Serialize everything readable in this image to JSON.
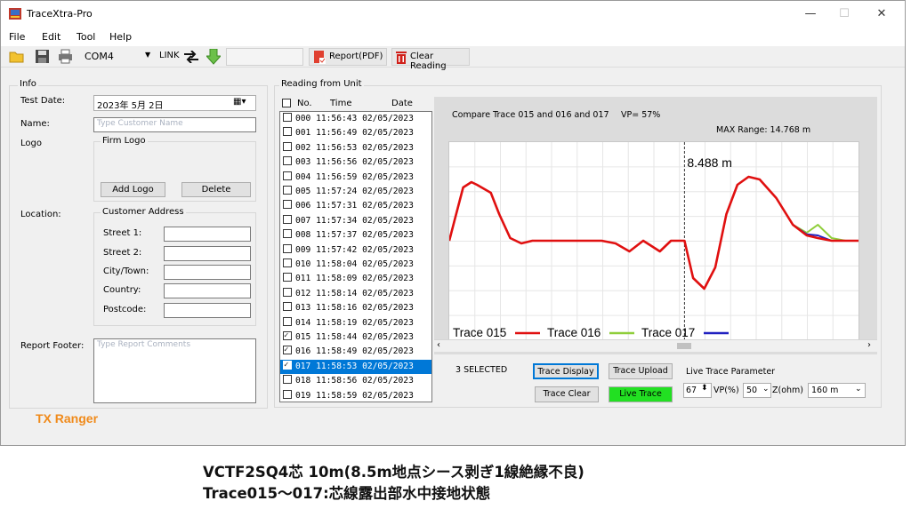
{
  "window": {
    "title": "TraceXtra-Pro",
    "controls": {
      "minimize": "—",
      "maximize": "☐",
      "close": "✕"
    }
  },
  "menu": [
    "File",
    "Edit",
    "Tool",
    "Help"
  ],
  "toolbar": {
    "port": "COM4",
    "link_label": "LINK",
    "report_label": "Report(PDF)",
    "clear_label": "Clear Reading"
  },
  "info": {
    "group_label": "Info",
    "test_date_label": "Test Date:",
    "test_date_value": "2023年 5月 2日",
    "name_label": "Name:",
    "name_placeholder": "Type Customer Name",
    "logo_label": "Logo",
    "firm_logo_label": "Firm Logo",
    "add_logo_button": "Add Logo",
    "delete_button": "Delete",
    "location_label": "Location:",
    "address_group": "Customer Address",
    "street1": "Street 1:",
    "street2": "Street 2:",
    "city": "City/Town:",
    "country": "Country:",
    "postcode": "Postcode:",
    "footer_label": "Report Footer:",
    "footer_placeholder": "Type Report Comments",
    "brand": "TX Ranger"
  },
  "readings": {
    "group_label": "Reading from Unit",
    "col_no": "No.",
    "col_time": "Time",
    "col_date": "Date",
    "rows": [
      {
        "no": "000",
        "time": "11:56:43",
        "date": "02/05/2023",
        "checked": false
      },
      {
        "no": "001",
        "time": "11:56:49",
        "date": "02/05/2023",
        "checked": false
      },
      {
        "no": "002",
        "time": "11:56:53",
        "date": "02/05/2023",
        "checked": false
      },
      {
        "no": "003",
        "time": "11:56:56",
        "date": "02/05/2023",
        "checked": false
      },
      {
        "no": "004",
        "time": "11:56:59",
        "date": "02/05/2023",
        "checked": false
      },
      {
        "no": "005",
        "time": "11:57:24",
        "date": "02/05/2023",
        "checked": false
      },
      {
        "no": "006",
        "time": "11:57:31",
        "date": "02/05/2023",
        "checked": false
      },
      {
        "no": "007",
        "time": "11:57:34",
        "date": "02/05/2023",
        "checked": false
      },
      {
        "no": "008",
        "time": "11:57:37",
        "date": "02/05/2023",
        "checked": false
      },
      {
        "no": "009",
        "time": "11:57:42",
        "date": "02/05/2023",
        "checked": false
      },
      {
        "no": "010",
        "time": "11:58:04",
        "date": "02/05/2023",
        "checked": false
      },
      {
        "no": "011",
        "time": "11:58:09",
        "date": "02/05/2023",
        "checked": false
      },
      {
        "no": "012",
        "time": "11:58:14",
        "date": "02/05/2023",
        "checked": false
      },
      {
        "no": "013",
        "time": "11:58:16",
        "date": "02/05/2023",
        "checked": false
      },
      {
        "no": "014",
        "time": "11:58:19",
        "date": "02/05/2023",
        "checked": false
      },
      {
        "no": "015",
        "time": "11:58:44",
        "date": "02/05/2023",
        "checked": true
      },
      {
        "no": "016",
        "time": "11:58:49",
        "date": "02/05/2023",
        "checked": true
      },
      {
        "no": "017",
        "time": "11:58:53",
        "date": "02/05/2023",
        "checked": true,
        "selected": true
      },
      {
        "no": "018",
        "time": "11:58:56",
        "date": "02/05/2023",
        "checked": false
      },
      {
        "no": "019",
        "time": "11:58:59",
        "date": "02/05/2023",
        "checked": false
      }
    ]
  },
  "chart": {
    "compare_label": "Compare Trace 015 and 016 and 017",
    "vp_label": "VP= 57%",
    "max_range": "MAX Range: 14.768 m",
    "cursor_label": "8.488 m",
    "legend": [
      {
        "name": "Trace 015",
        "color": "#e01010"
      },
      {
        "name": "Trace 016",
        "color": "#8fce3a"
      },
      {
        "name": "Trace 017",
        "color": "#2020c0"
      }
    ]
  },
  "controls": {
    "selected_count": "3 SELECTED",
    "trace_display": "Trace Display",
    "trace_upload": "Trace Upload",
    "trace_clear": "Trace Clear",
    "live_trace": "Live Trace",
    "live_param_label": "Live Trace Parameter",
    "vp_value": "67",
    "vp_unit": "VP(%)",
    "z_value": "50",
    "z_unit": "Z(ohm)",
    "range_value": "160 m"
  },
  "caption": {
    "line1": "VCTF2SQ4芯 10m(8.5m地点シース剥ぎ1線絶縁不良)",
    "line2": "Trace015～017:芯線露出部水中接地状態"
  },
  "chart_data": {
    "type": "line",
    "title": "Compare Trace 015 and 016 and 017",
    "xlim": [
      0,
      14.768
    ],
    "cursor_x": 8.488,
    "series": [
      {
        "name": "Trace 015",
        "color": "#e01010",
        "x": [
          0,
          0.2,
          0.5,
          0.8,
          1.0,
          1.5,
          1.8,
          2.2,
          2.6,
          3.0,
          4.0,
          5.0,
          5.5,
          6.0,
          6.5,
          7.0,
          7.3,
          7.6,
          8.0,
          8.488,
          8.8,
          9.2,
          9.6,
          10.0,
          10.4,
          10.8,
          11.2,
          11.8,
          12.4,
          12.9,
          13.3,
          13.8,
          14.3,
          14.768
        ],
        "y": [
          0.0,
          0.4,
          1.0,
          1.1,
          1.05,
          0.9,
          0.5,
          0.05,
          -0.05,
          0.0,
          0.0,
          0.0,
          0.0,
          -0.05,
          -0.2,
          0.0,
          -0.1,
          -0.2,
          0.0,
          0.0,
          -0.7,
          -0.9,
          -0.5,
          0.5,
          1.05,
          1.2,
          1.15,
          0.8,
          0.3,
          0.1,
          0.05,
          0.0,
          0.0,
          0.0
        ]
      },
      {
        "name": "Trace 016",
        "color": "#8fce3a",
        "x": [
          12.4,
          12.9,
          13.3,
          13.8,
          14.3
        ],
        "y": [
          0.3,
          0.15,
          0.3,
          0.05,
          0.0
        ]
      },
      {
        "name": "Trace 017",
        "color": "#2020c0",
        "x": [
          12.4,
          12.9,
          13.3,
          13.8,
          14.3
        ],
        "y": [
          0.3,
          0.12,
          0.1,
          0.0,
          0.0
        ]
      }
    ]
  }
}
